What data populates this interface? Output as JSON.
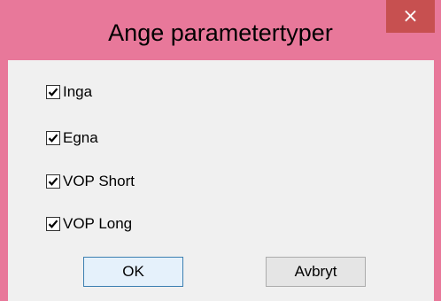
{
  "window": {
    "title": "Ange parametertyper",
    "close_glyph": "×"
  },
  "checkboxes": [
    {
      "label": "Inga",
      "checked": true
    },
    {
      "label": "Egna",
      "checked": true
    },
    {
      "label": "VOP Short",
      "checked": true
    },
    {
      "label": "VOP Long",
      "checked": true
    }
  ],
  "buttons": {
    "ok_label": "OK",
    "cancel_label": "Avbryt"
  },
  "colors": {
    "frame": "#e8789a",
    "close_button": "#c75050",
    "client_background": "#f0f0f0"
  }
}
